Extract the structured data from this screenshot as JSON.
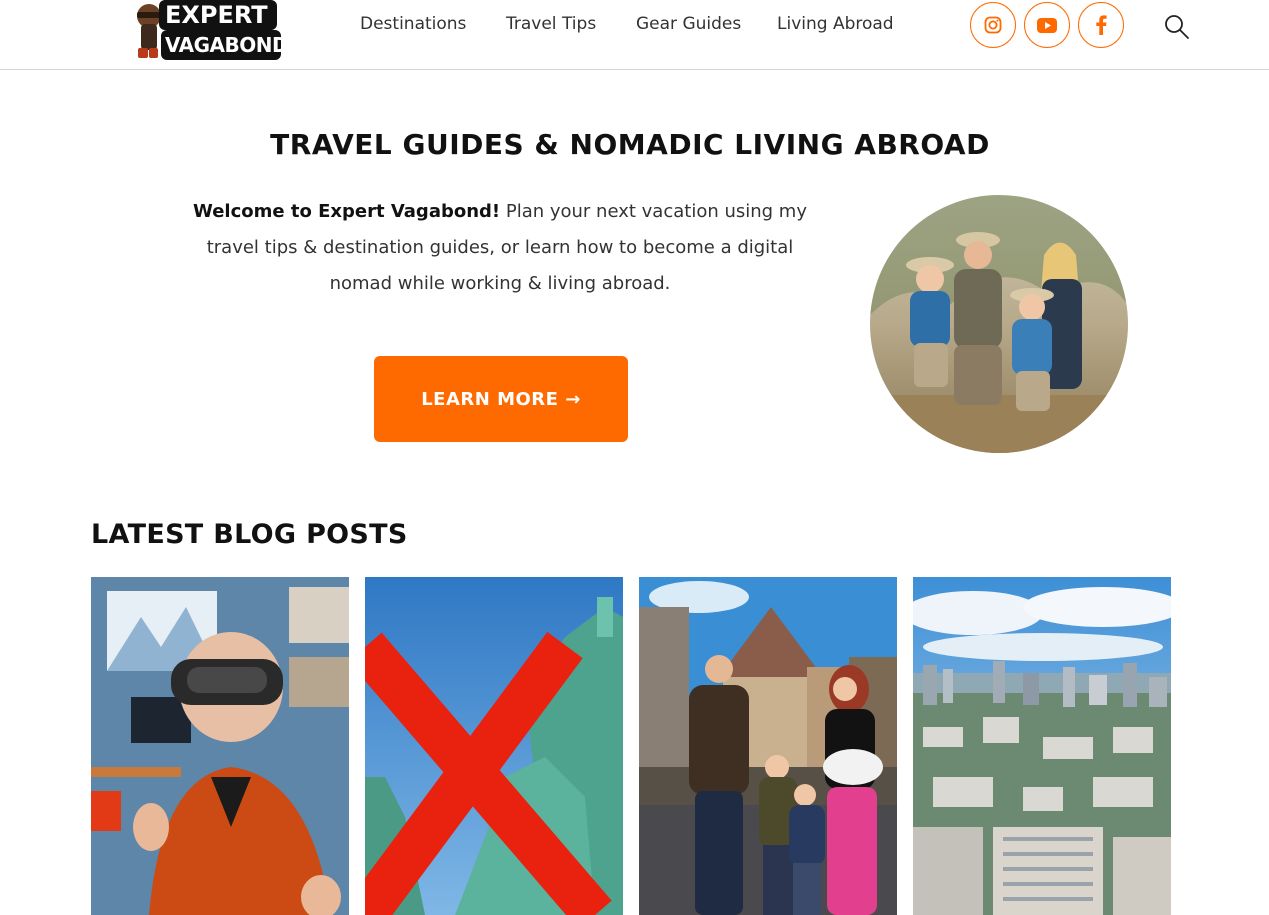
{
  "header": {
    "logo": {
      "line1": "EXPERT",
      "line2": "VAGABOND"
    },
    "nav": [
      "Destinations",
      "Travel Tips",
      "Gear Guides",
      "Living Abroad"
    ],
    "social": [
      "instagram-icon",
      "youtube-icon",
      "facebook-icon"
    ],
    "search_icon": "search-icon"
  },
  "hero": {
    "title": "TRAVEL GUIDES & NOMADIC LIVING ABROAD",
    "intro_bold": "Welcome to Expert Vagabond!",
    "intro_rest": " Plan your next vacation using my travel tips & destination guides, or learn how to become a digital nomad while working & living abroad.",
    "cta": "LEARN MORE →"
  },
  "blog": {
    "heading": "LATEST BLOG POSTS"
  },
  "colors": {
    "accent": "#ff6a00",
    "text": "#222222"
  }
}
